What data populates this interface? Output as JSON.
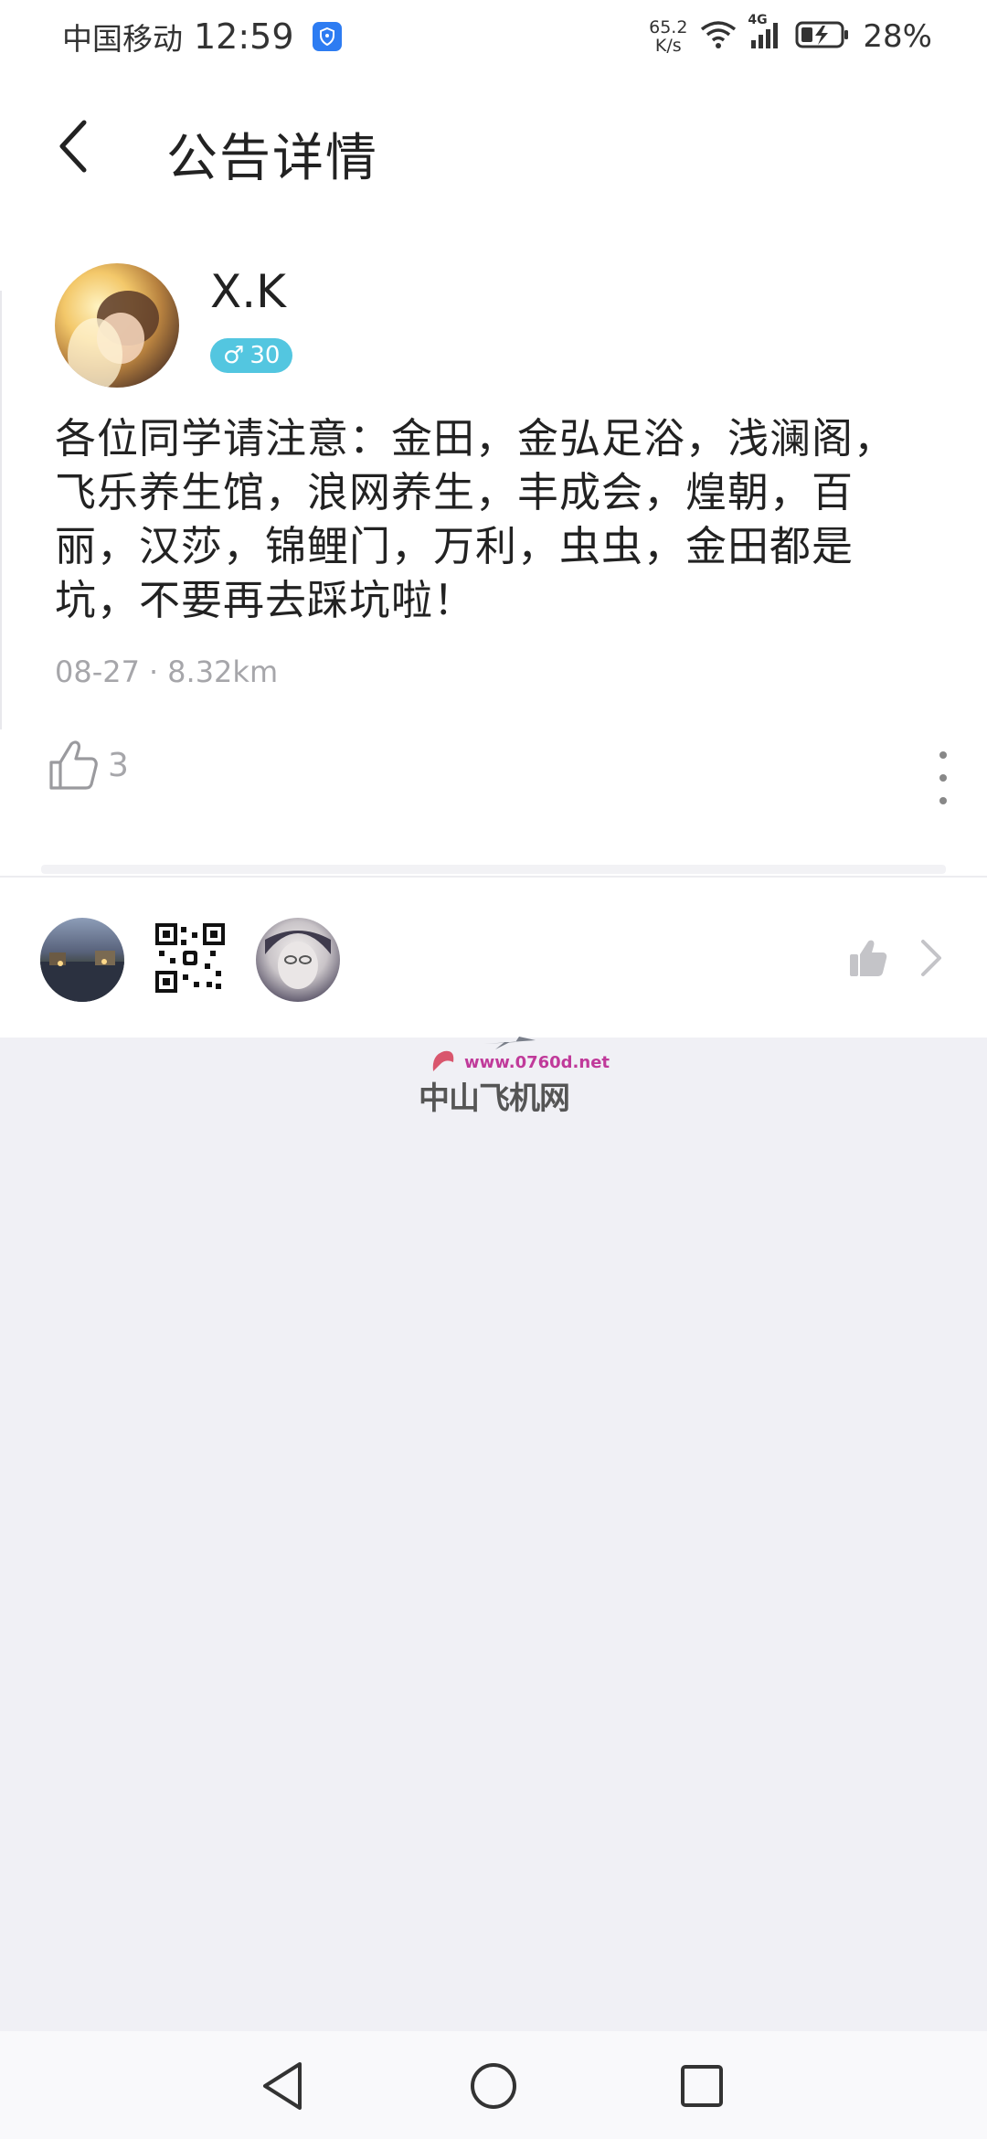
{
  "status_bar": {
    "carrier": "中国移动",
    "time": "12:59",
    "net_speed_value": "65.2",
    "net_speed_unit": "K/s",
    "network_type": "4G",
    "battery_percent": "28%"
  },
  "header": {
    "title": "公告详情"
  },
  "post": {
    "author": "X.K",
    "gender_symbol": "♂",
    "age": "30",
    "body": "各位同学请注意：金田，金弘足浴，浅澜阁，飞乐养生馆，浪网养生，丰成会，煌朝，百丽，汉莎，锦鲤门，万利，虫虫，金田都是坑，不要再去踩坑啦！",
    "date": "08-27",
    "distance": "8.32km",
    "like_count": "3"
  },
  "watermark": {
    "url": "www.0760d.net",
    "name": "中山飞机网"
  },
  "colors": {
    "accent_badge": "#53c6e0",
    "page_background": "#f0f0f5"
  }
}
